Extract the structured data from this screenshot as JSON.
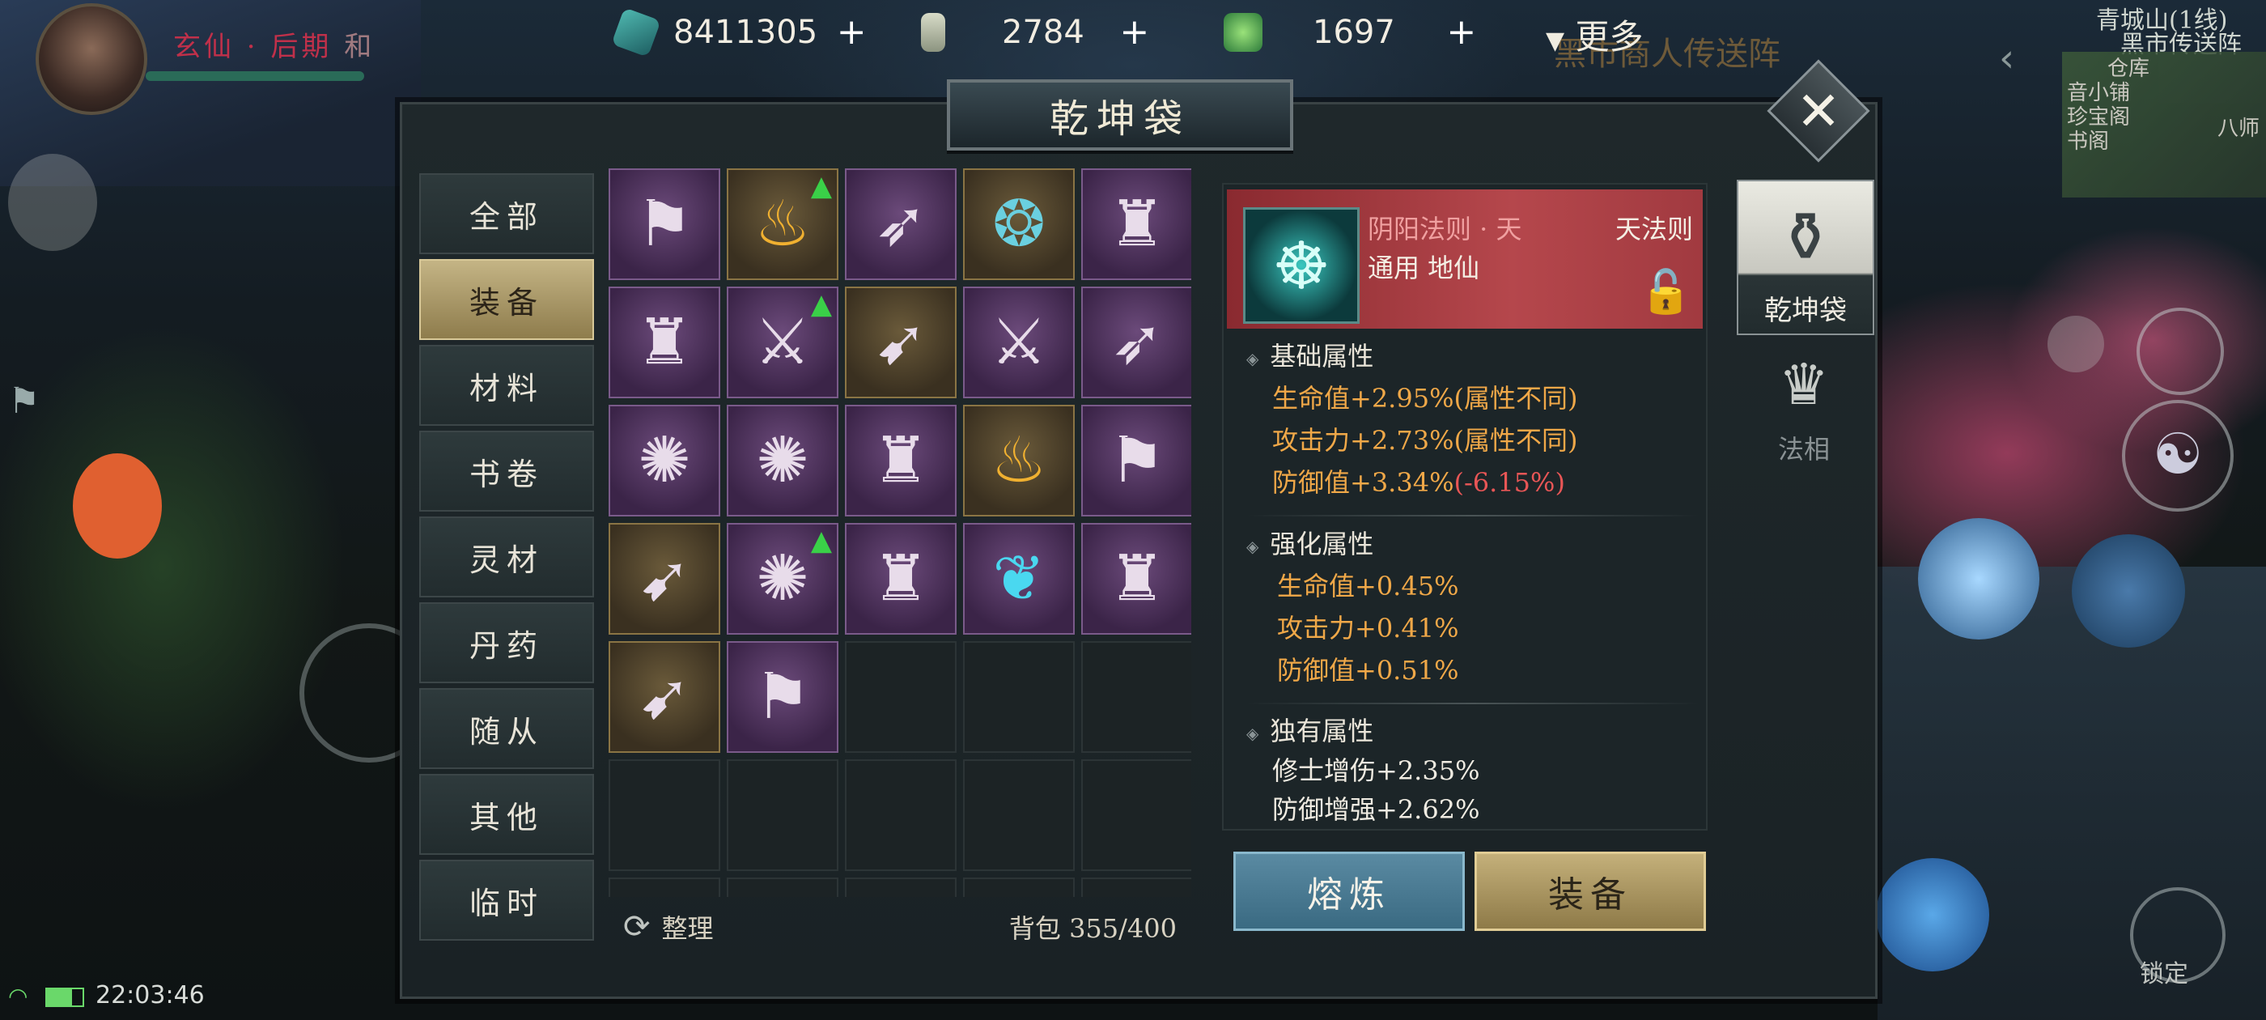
{
  "hud": {
    "player_rank": "玄仙 · 后期",
    "player_rank_suffix": "和",
    "resources": [
      {
        "icon": "jade-crystal-icon",
        "value": "8411305"
      },
      {
        "icon": "talisman-icon",
        "value": "2784"
      },
      {
        "icon": "green-coin-icon",
        "value": "1697"
      }
    ],
    "more_label": "更多",
    "portal_text": "黑市商人传送阵",
    "map_name": "青城山(1线)",
    "map_place": "黑市传送阵",
    "map_marks": [
      "仓库",
      "音小铺",
      "珍宝阁",
      "书阁",
      "八师"
    ]
  },
  "panel": {
    "title": "乾坤袋",
    "categories": [
      {
        "label": "全部",
        "active": false
      },
      {
        "label": "装备",
        "active": true
      },
      {
        "label": "材料",
        "active": false
      },
      {
        "label": "书卷",
        "active": false
      },
      {
        "label": "灵材",
        "active": false
      },
      {
        "label": "丹药",
        "active": false
      },
      {
        "label": "随从",
        "active": false
      },
      {
        "label": "其他",
        "active": false
      },
      {
        "label": "临时",
        "active": false
      }
    ],
    "sort_label": "整理",
    "bag_label": "背包",
    "bag_count": "355/400",
    "grid": [
      [
        "banner",
        "golden-cauldron",
        "crossbow",
        "jade-mirror",
        "armor-chest"
      ],
      [
        "armor-chest",
        "sword",
        "arrows",
        "sword",
        "crossbow"
      ],
      [
        "flail",
        "flail",
        "armor-chest",
        "golden-cauldron",
        "banner"
      ],
      [
        "arrows",
        "flail",
        "armor-chest",
        "azure-scroll",
        "armor-chest"
      ],
      [
        "arrows",
        "banner",
        "",
        "",
        ""
      ],
      [
        "",
        "",
        "",
        "",
        ""
      ],
      [
        "",
        "",
        "",
        "",
        ""
      ]
    ],
    "upgrade_arrows": [
      [
        0,
        1
      ],
      [
        1,
        1
      ],
      [
        3,
        1
      ]
    ]
  },
  "detail": {
    "name": "阴阳法则 · 天",
    "type": "天法则",
    "usage": "通用 地仙",
    "sections": [
      {
        "title": "基础属性",
        "stats": [
          {
            "text": "生命值+2.95%",
            "extra": "(属性不同)",
            "extra_neg": false
          },
          {
            "text": "攻击力+2.73%",
            "extra": "(属性不同)",
            "extra_neg": false
          },
          {
            "text": "防御值+3.34%",
            "extra": "(-6.15%)",
            "extra_neg": true
          }
        ]
      },
      {
        "title": "强化属性",
        "stats": [
          {
            "text": "生命值+0.45%"
          },
          {
            "text": "攻击力+0.41%"
          },
          {
            "text": "防御值+0.51%"
          }
        ]
      },
      {
        "title": "独有属性",
        "stats": [
          {
            "text": "修士增伤+2.35%"
          },
          {
            "text": "防御增强+2.62%"
          }
        ]
      }
    ],
    "smelt_label": "熔炼",
    "equip_label": "装备"
  },
  "right_tabs": [
    {
      "label": "乾坤袋",
      "icon": "pouch-icon"
    },
    {
      "label": "法相",
      "icon": "crown-icon"
    }
  ],
  "status": {
    "clock": "22:03:46",
    "lock_label": "锁定"
  },
  "colors": {
    "accent_gold": "#c4b485",
    "item_purple": "#6b4a7a",
    "detail_red": "#b5474c",
    "stat_gold": "#f0a848",
    "stat_negative": "#e85656"
  }
}
